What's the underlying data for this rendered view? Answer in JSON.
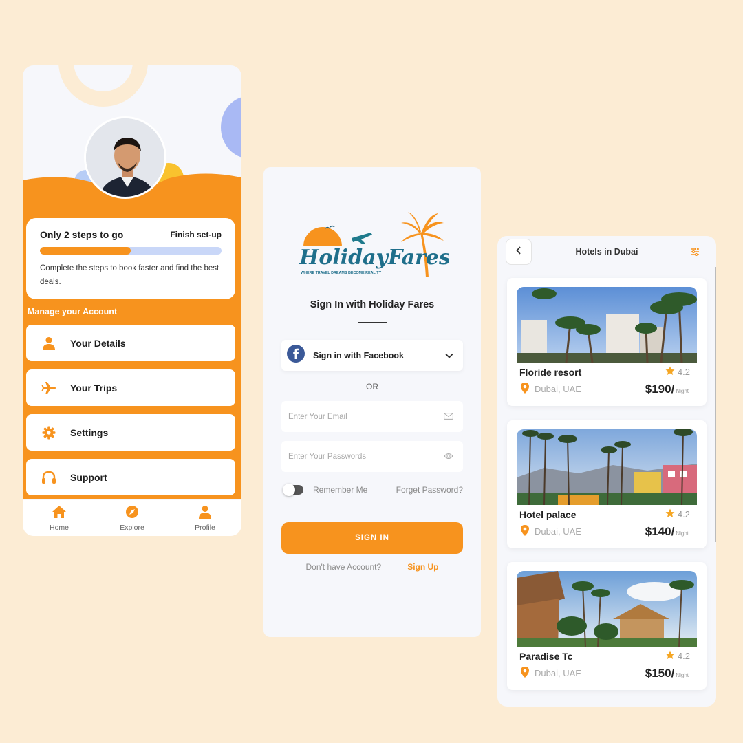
{
  "profile": {
    "steps_title": "Only 2 steps to go",
    "finish_label": "Finish set-up",
    "progress": 0.5,
    "steps_desc": "Complete the steps to book faster and find the best deals.",
    "manage_heading": "Manage your Account",
    "menu": [
      {
        "label": "Your Details",
        "icon": "user-icon"
      },
      {
        "label": "Your Trips",
        "icon": "plane-icon"
      },
      {
        "label": "Settings",
        "icon": "gear-icon"
      },
      {
        "label": "Support",
        "icon": "headphones-icon"
      }
    ],
    "nav": [
      {
        "label": "Home",
        "icon": "home-icon"
      },
      {
        "label": "Explore",
        "icon": "compass-icon"
      },
      {
        "label": "Profile",
        "icon": "profile-icon"
      }
    ]
  },
  "signin": {
    "logo_text": "HolidayFares",
    "logo_tagline": "WHERE TRAVEL DREAMS BECOME REALITY",
    "title": "Sign In with Holiday Fares",
    "facebook_label": "Sign in with Facebook",
    "or_label": "OR",
    "email_placeholder": "Enter Your Email",
    "password_placeholder": "Enter Your Passwords",
    "remember_label": "Remember Me",
    "forget_label": "Forget Password?",
    "signin_button": "SIGN IN",
    "no_account": "Don't have Account?",
    "signup_link": "Sign Up"
  },
  "hotels": {
    "title": "Hotels in Dubai",
    "items": [
      {
        "name": "Floride resort",
        "rating": "4.2",
        "location": "Dubai, UAE",
        "price": "$190/",
        "per": "Night"
      },
      {
        "name": "Hotel palace",
        "rating": "4.2",
        "location": "Dubai, UAE",
        "price": "$140/",
        "per": "Night"
      },
      {
        "name": "Paradise Tc",
        "rating": "4.2",
        "location": "Dubai, UAE",
        "price": "$150/",
        "per": "Night"
      }
    ]
  },
  "colors": {
    "accent": "#f7931e",
    "background": "#fcecd4",
    "progress_track": "#c9d7f8",
    "facebook": "#3b5998"
  }
}
